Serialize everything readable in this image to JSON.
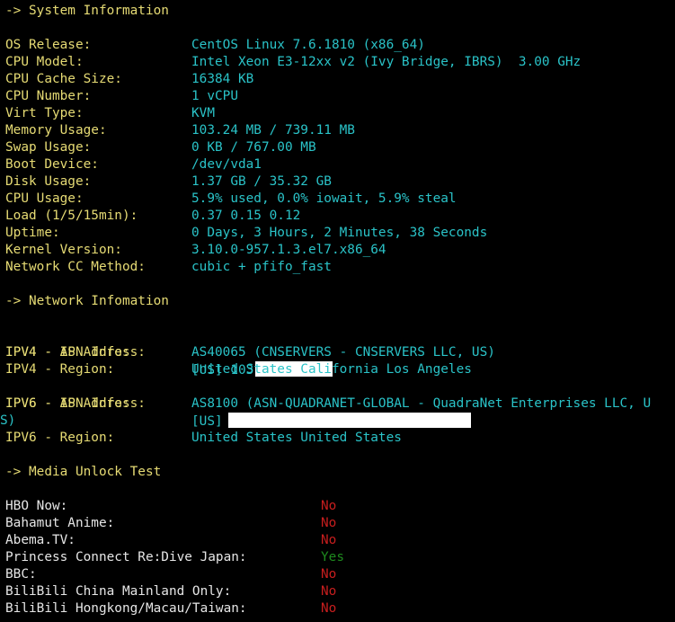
{
  "system": {
    "header": "-> System Information",
    "rows": [
      {
        "label": "OS Release:",
        "value": "CentOS Linux 7.6.1810 (x86_64)"
      },
      {
        "label": "CPU Model:",
        "value": "Intel Xeon E3-12xx v2 (Ivy Bridge, IBRS)  3.00 GHz"
      },
      {
        "label": "CPU Cache Size:",
        "value": "16384 KB"
      },
      {
        "label": "CPU Number:",
        "value": "1 vCPU"
      },
      {
        "label": "Virt Type:",
        "value": "KVM"
      },
      {
        "label": "Memory Usage:",
        "value": "103.24 MB / 739.11 MB"
      },
      {
        "label": "Swap Usage:",
        "value": "0 KB / 767.00 MB"
      },
      {
        "label": "Boot Device:",
        "value": "/dev/vda1"
      },
      {
        "label": "Disk Usage:",
        "value": "1.37 GB / 35.32 GB"
      },
      {
        "label": "CPU Usage:",
        "value": "5.9% used, 0.0% iowait, 5.9% steal"
      },
      {
        "label": "Load (1/5/15min):",
        "value": "0.37 0.15 0.12"
      },
      {
        "label": "Uptime:",
        "value": "0 Days, 3 Hours, 2 Minutes, 38 Seconds"
      },
      {
        "label": "Kernel Version:",
        "value": "3.10.0-957.1.3.el7.x86_64"
      },
      {
        "label": "Network CC Method:",
        "value": "cubic + pfifo_fast"
      }
    ]
  },
  "network": {
    "header": "-> Network Infomation",
    "ipv4_ip_label": "IPV4 - IP Address:",
    "ipv4_ip_value": "[US] 103",
    "ipv4_asn_label": "IPV4 - ASN Info:",
    "ipv4_asn_value": "AS40065 (CNSERVERS - CNSERVERS LLC, US)",
    "ipv4_region_label": "IPV4 - Region:",
    "ipv4_region_value": "United States California Los Angeles",
    "ipv6_ip_label": "IPV6 - IP Address:",
    "ipv6_ip_value": "[US]",
    "ipv6_asn_label": "IPV6 - ASN Info:",
    "ipv6_asn_value": "AS8100 (ASN-QUADRANET-GLOBAL - QuadraNet Enterprises LLC, U",
    "ipv6_asn_wrap": "S)",
    "ipv6_region_label": "IPV6 - Region:",
    "ipv6_region_value": "United States United States"
  },
  "media": {
    "header": "-> Media Unlock Test",
    "rows": [
      {
        "label": "HBO Now:",
        "value": "No"
      },
      {
        "label": "Bahamut Anime:",
        "value": "No"
      },
      {
        "label": "Abema.TV:",
        "value": "No"
      },
      {
        "label": "Princess Connect Re:Dive Japan:",
        "value": "Yes"
      },
      {
        "label": "BBC:",
        "value": "No"
      },
      {
        "label": "BiliBili China Mainland Only:",
        "value": "No"
      },
      {
        "label": "BiliBili Hongkong/Macau/Taiwan:",
        "value": "No"
      }
    ]
  },
  "colors": {
    "background": "#000000",
    "label": "#e6db74",
    "value": "#2ac3c8",
    "no": "#c81e1e",
    "yes": "#1e8a1e"
  }
}
